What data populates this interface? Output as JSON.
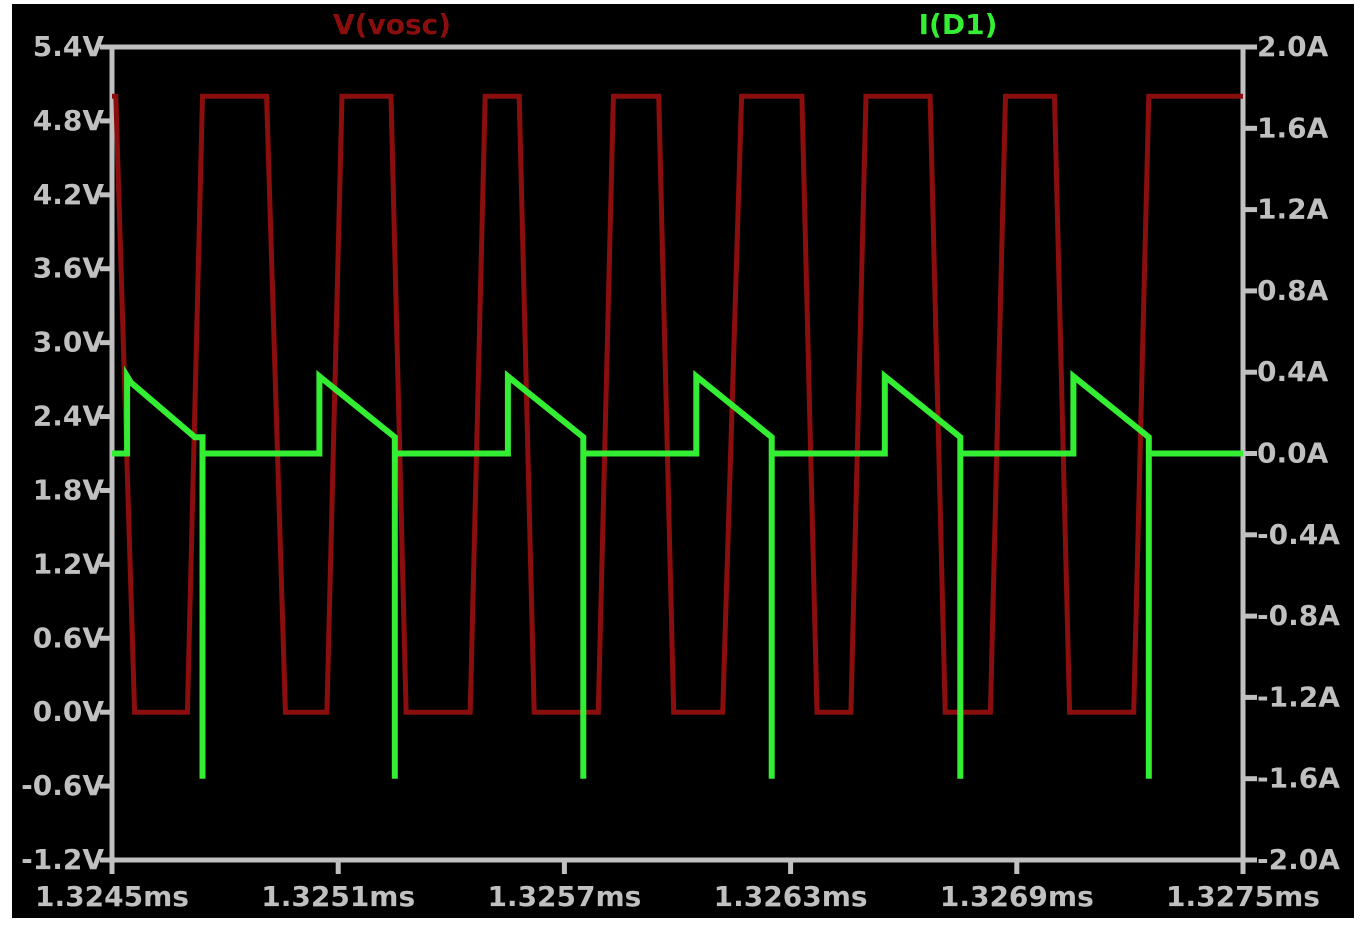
{
  "chart_data": {
    "type": "line",
    "title": "",
    "xlabel": "",
    "ylabel": "",
    "y2label": "",
    "grid": false,
    "background": "#000000",
    "axis_color": "#c0c0c0",
    "legend": {
      "placement": "top",
      "entries": [
        "V(vosc)",
        "I(D1)"
      ]
    },
    "x_axis": {
      "unit": "ms",
      "range": [
        1.3245,
        1.3275
      ],
      "ticks": [
        1.3245,
        1.3251,
        1.3257,
        1.3263,
        1.3269,
        1.3275
      ],
      "tick_labels": [
        "1.3245ms",
        "1.3251ms",
        "1.3257ms",
        "1.3263ms",
        "1.3269ms",
        "1.3275ms"
      ]
    },
    "y_axis_left": {
      "unit": "V",
      "range": [
        -1.2,
        5.4
      ],
      "ticks": [
        5.4,
        4.8,
        4.2,
        3.6,
        3.0,
        2.4,
        1.8,
        1.2,
        0.6,
        0.0,
        -0.6,
        -1.2
      ],
      "tick_labels": [
        "5.4V",
        "4.8V",
        "4.2V",
        "3.6V",
        "3.0V",
        "2.4V",
        "1.8V",
        "1.2V",
        "0.6V",
        "0.0V",
        "-0.6V",
        "-1.2V"
      ]
    },
    "y_axis_right": {
      "unit": "A",
      "range": [
        -2.0,
        2.0
      ],
      "ticks": [
        2.0,
        1.6,
        1.2,
        0.8,
        0.4,
        0.0,
        -0.4,
        -0.8,
        -1.2,
        -1.6,
        -2.0
      ],
      "tick_labels": [
        "2.0A",
        "1.6A",
        "1.2A",
        "0.8A",
        "0.4A",
        "0.0A",
        "-0.4A",
        "-0.8A",
        "-1.2A",
        "-1.6A",
        "-2.0A"
      ]
    },
    "series": [
      {
        "name": "V(vosc)",
        "axis": "left",
        "color": "#8b0e0e",
        "x": [
          1.3245,
          1.32451,
          1.32456,
          1.3247,
          1.32474,
          1.32491,
          1.32496,
          1.32507,
          1.32511,
          1.32524,
          1.32528,
          1.32545,
          1.32549,
          1.32558,
          1.32562,
          1.32579,
          1.32583,
          1.32595,
          1.32599,
          1.32612,
          1.32617,
          1.32633,
          1.32637,
          1.32646,
          1.3265,
          1.32667,
          1.32671,
          1.32683,
          1.32687,
          1.327,
          1.32704,
          1.32721,
          1.32725,
          1.32734,
          1.32738,
          1.3275
        ],
        "y": [
          5.0,
          5.0,
          0.0,
          0.0,
          5.0,
          5.0,
          0.0,
          0.0,
          5.0,
          5.0,
          0.0,
          0.0,
          5.0,
          5.0,
          0.0,
          0.0,
          5.0,
          5.0,
          0.0,
          0.0,
          5.0,
          5.0,
          0.0,
          0.0,
          5.0,
          5.0,
          0.0,
          0.0,
          5.0,
          5.0,
          0.0,
          0.0,
          5.0,
          5.0,
          5.0,
          5.0
        ]
      },
      {
        "name": "I(D1)",
        "axis": "right",
        "color": "#33ee33",
        "x": [
          1.3245,
          1.32454,
          1.32454,
          1.32455,
          1.32472,
          1.32474,
          1.32474,
          1.32474,
          1.32475,
          1.3248,
          1.32505,
          1.32505,
          1.32507,
          1.32525,
          1.32525,
          1.32525,
          1.32525,
          1.3253,
          1.32555,
          1.32555,
          1.32557,
          1.32575,
          1.32575,
          1.32575,
          1.32575,
          1.3258,
          1.32605,
          1.32605,
          1.32607,
          1.32625,
          1.32625,
          1.32625,
          1.32625,
          1.3263,
          1.32655,
          1.32655,
          1.32657,
          1.32675,
          1.32675,
          1.32675,
          1.32675,
          1.3268,
          1.32705,
          1.32705,
          1.32707,
          1.32725,
          1.32725,
          1.32725,
          1.32725,
          1.3275
        ],
        "y": [
          0.0,
          0.0,
          0.38,
          0.35,
          0.08,
          0.08,
          -1.6,
          0.0,
          0.0,
          0.0,
          0.0,
          0.38,
          0.35,
          0.08,
          -1.6,
          0.0,
          0.0,
          0.0,
          0.0,
          0.38,
          0.35,
          0.08,
          -1.6,
          0.0,
          0.0,
          0.0,
          0.0,
          0.38,
          0.35,
          0.08,
          -1.6,
          0.0,
          0.0,
          0.0,
          0.0,
          0.38,
          0.35,
          0.08,
          -1.6,
          0.0,
          0.0,
          0.0,
          0.0,
          0.38,
          0.35,
          0.08,
          -1.6,
          0.0,
          0.0,
          0.0
        ]
      }
    ]
  }
}
